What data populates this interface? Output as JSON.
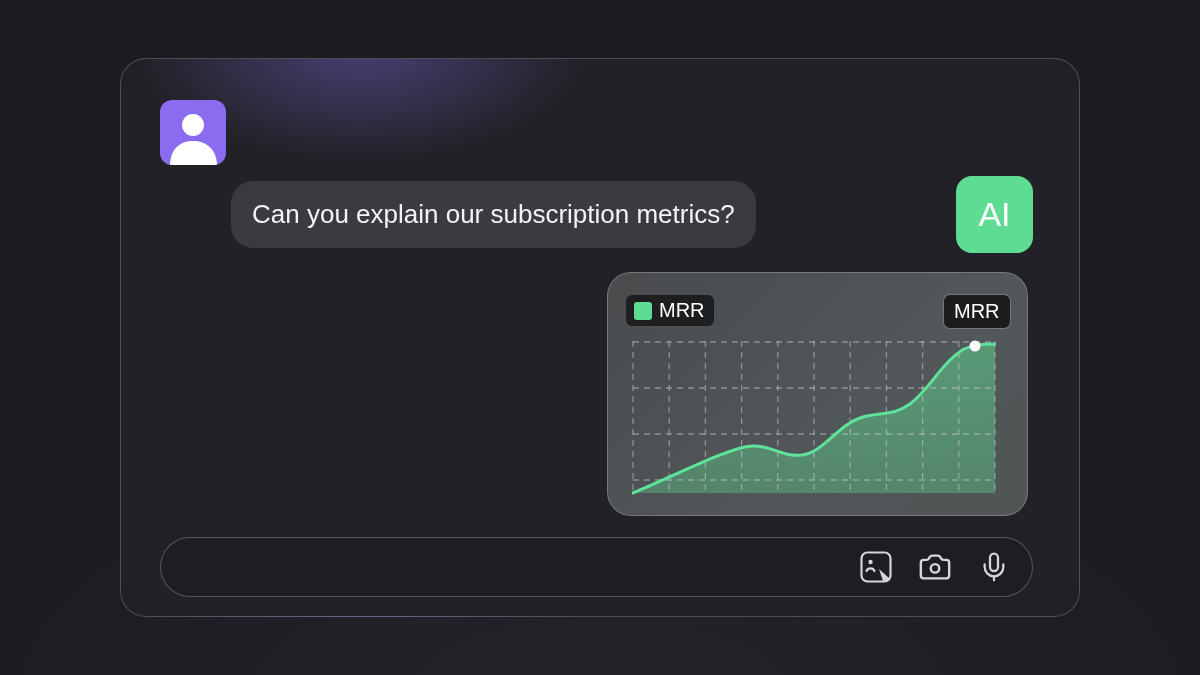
{
  "user": {
    "message": "Can you explain our subscription metrics?"
  },
  "assistant": {
    "avatar_label": "AI",
    "chart": {
      "legend_label": "MRR",
      "tooltip_label": "MRR"
    }
  }
}
